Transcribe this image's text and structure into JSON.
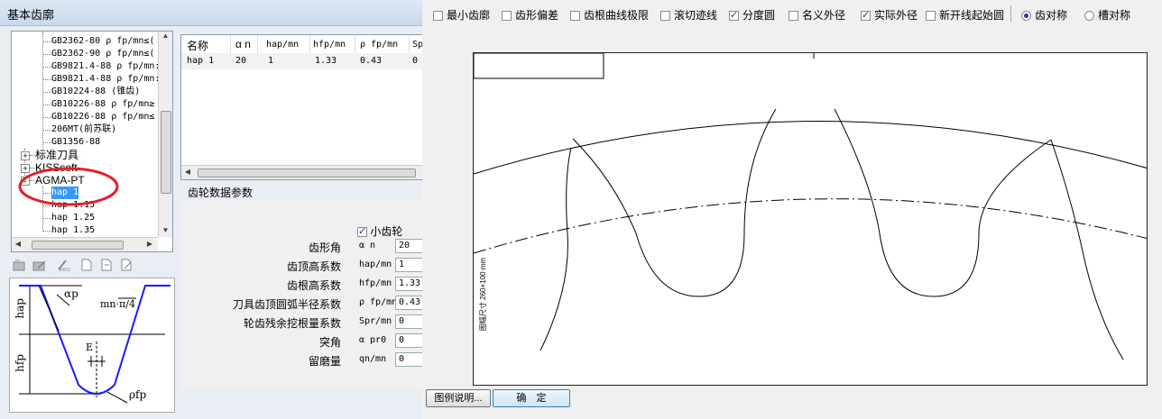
{
  "window": {
    "title": "基本齿廓"
  },
  "tree": {
    "items": [
      {
        "label": "GB2362-80 ρ fp/mn≤(",
        "level": 2
      },
      {
        "label": "GB2362-90 ρ fp/mn≤(",
        "level": 2
      },
      {
        "label": "GB9821.4-88 ρ fp/mn:",
        "level": 2
      },
      {
        "label": "GB9821.4-88 ρ fp/mn:",
        "level": 2
      },
      {
        "label": "GB10224-88 (锥齿)",
        "level": 2
      },
      {
        "label": "GB10226-88 ρ fp/mn≥",
        "level": 2
      },
      {
        "label": "GB10226-88 ρ fp/mn≤",
        "level": 2
      },
      {
        "label": "206MT(前苏联)",
        "level": 2
      },
      {
        "label": "GB1356-88",
        "level": 2
      },
      {
        "label": "标准刀具",
        "level": 1,
        "expander": "+"
      },
      {
        "label": "KISSsoft",
        "level": 1,
        "expander": "+"
      },
      {
        "label": "AGMA-PT",
        "level": 1,
        "expander": "-"
      },
      {
        "label": "hap 1",
        "level": 2,
        "selected": true
      },
      {
        "label": "hap 1.15",
        "level": 2
      },
      {
        "label": "hap 1.25",
        "level": 2
      },
      {
        "label": "hap 1.35",
        "level": 2
      }
    ]
  },
  "table": {
    "headers": [
      "名称",
      "α n",
      "hap/mn",
      "hfp/mn",
      "ρ fp/mn",
      "Sp"
    ],
    "rows": [
      [
        "hap 1",
        "20",
        "1",
        "1.33",
        "0.43",
        "0"
      ]
    ]
  },
  "params": {
    "section_title": "齿轮数据参数",
    "small_gear_label": "小齿轮",
    "small_gear_checked": true,
    "rows": [
      {
        "label": "齿形角",
        "symbol": "α n",
        "value": "20"
      },
      {
        "label": "齿顶高系数",
        "symbol": "hap/mn",
        "value": "1"
      },
      {
        "label": "齿根高系数",
        "symbol": "hfp/mn",
        "value": "1.33"
      },
      {
        "label": "刀具齿顶圆弧半径系数",
        "symbol": "ρ fp/mn",
        "value": "0.43"
      },
      {
        "label": "轮齿残余挖根量系数",
        "symbol": "Spr/mn",
        "value": "0"
      },
      {
        "label": "突角",
        "symbol": "α pr0",
        "value": "0"
      },
      {
        "label": "留磨量",
        "symbol": "qn/mn",
        "value": "0"
      }
    ]
  },
  "profile_labels": {
    "hap": "hap",
    "hfp": "hfp",
    "alpha": "αp",
    "pitch": "mn·π/4",
    "e": "E",
    "rho": "ρfp"
  },
  "options": {
    "checkboxes": [
      {
        "label": "最小齿廓",
        "checked": false
      },
      {
        "label": "齿形偏差",
        "checked": false
      },
      {
        "label": "齿根曲线极限",
        "checked": false
      },
      {
        "label": "滚切迹线",
        "checked": false
      },
      {
        "label": "分度圆",
        "checked": true
      },
      {
        "label": "名义外径",
        "checked": false
      },
      {
        "label": "实际外径",
        "checked": true
      },
      {
        "label": "新开线起始圆",
        "checked": false
      }
    ],
    "radios": [
      {
        "label": "齿对称",
        "checked": true
      },
      {
        "label": "槽对称",
        "checked": false
      }
    ]
  },
  "canvas": {
    "scale_label": "图幅尺寸 260×100 mm"
  },
  "buttons": {
    "legend": "图例说明...",
    "ok": "确　定"
  },
  "colors": {
    "selection": "#3399ff",
    "profile_line": "#1a1aff",
    "annotation": "#e0202a"
  }
}
